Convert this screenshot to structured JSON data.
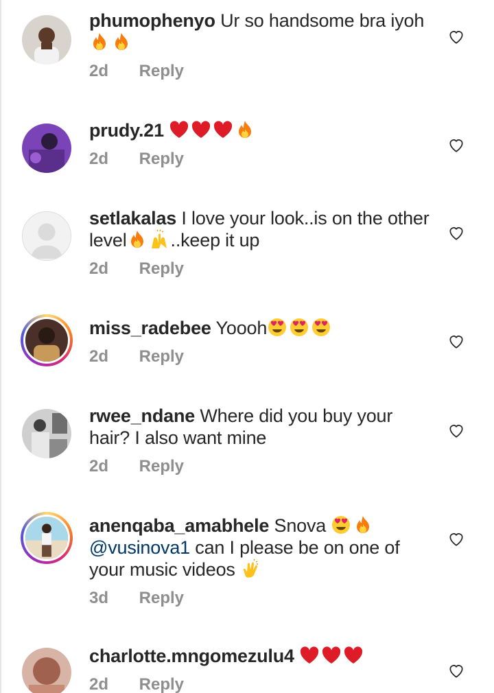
{
  "comments": [
    {
      "username": "phumophenyo",
      "text": "Ur so handsome bra iyoh",
      "emojis": [
        "fire",
        "fire"
      ],
      "time": "2d",
      "reply_label": "Reply",
      "avatar_color": "#c9c2bd",
      "story_ring": false
    },
    {
      "username": "prudy.21",
      "text": "",
      "emojis": [
        "red-heart",
        "red-heart",
        "red-heart",
        "fire"
      ],
      "time": "2d",
      "reply_label": "Reply",
      "avatar_color": "#6a3a9e",
      "story_ring": false
    },
    {
      "username": "setlakalas",
      "text": "I love your look..is on the other level",
      "emojis_mid": [
        "fire",
        "raising-hands"
      ],
      "text_after": "..keep it up",
      "time": "2d",
      "reply_label": "Reply",
      "avatar_color": "#dbdbdb",
      "story_ring": false
    },
    {
      "username": "miss_radebee",
      "text": "Yoooh",
      "emojis": [
        "heart-eyes",
        "heart-eyes",
        "heart-eyes"
      ],
      "time": "2d",
      "reply_label": "Reply",
      "avatar_color": "#3a2a24",
      "story_ring": true
    },
    {
      "username": "rwee_ndane",
      "text": "Where did you buy your hair? I also want mine",
      "time": "2d",
      "reply_label": "Reply",
      "avatar_color": "#9a9a9a",
      "story_ring": false
    },
    {
      "username": "anenqaba_amabhele",
      "text": "Snova",
      "emojis": [
        "heart-eyes",
        "fire"
      ],
      "mention": "@vusinova1",
      "text_after": " can I please be on one of your music videos",
      "emojis_after": [
        "clapping-hands"
      ],
      "time": "3d",
      "reply_label": "Reply",
      "avatar_color": "#8ec6d8",
      "story_ring": true
    },
    {
      "username": "charlotte.mngomezulu4",
      "text": "",
      "emojis": [
        "red-heart",
        "red-heart",
        "red-heart"
      ],
      "time": "2d",
      "reply_label": "Reply",
      "avatar_color": "#b07a6a",
      "story_ring": false
    }
  ]
}
